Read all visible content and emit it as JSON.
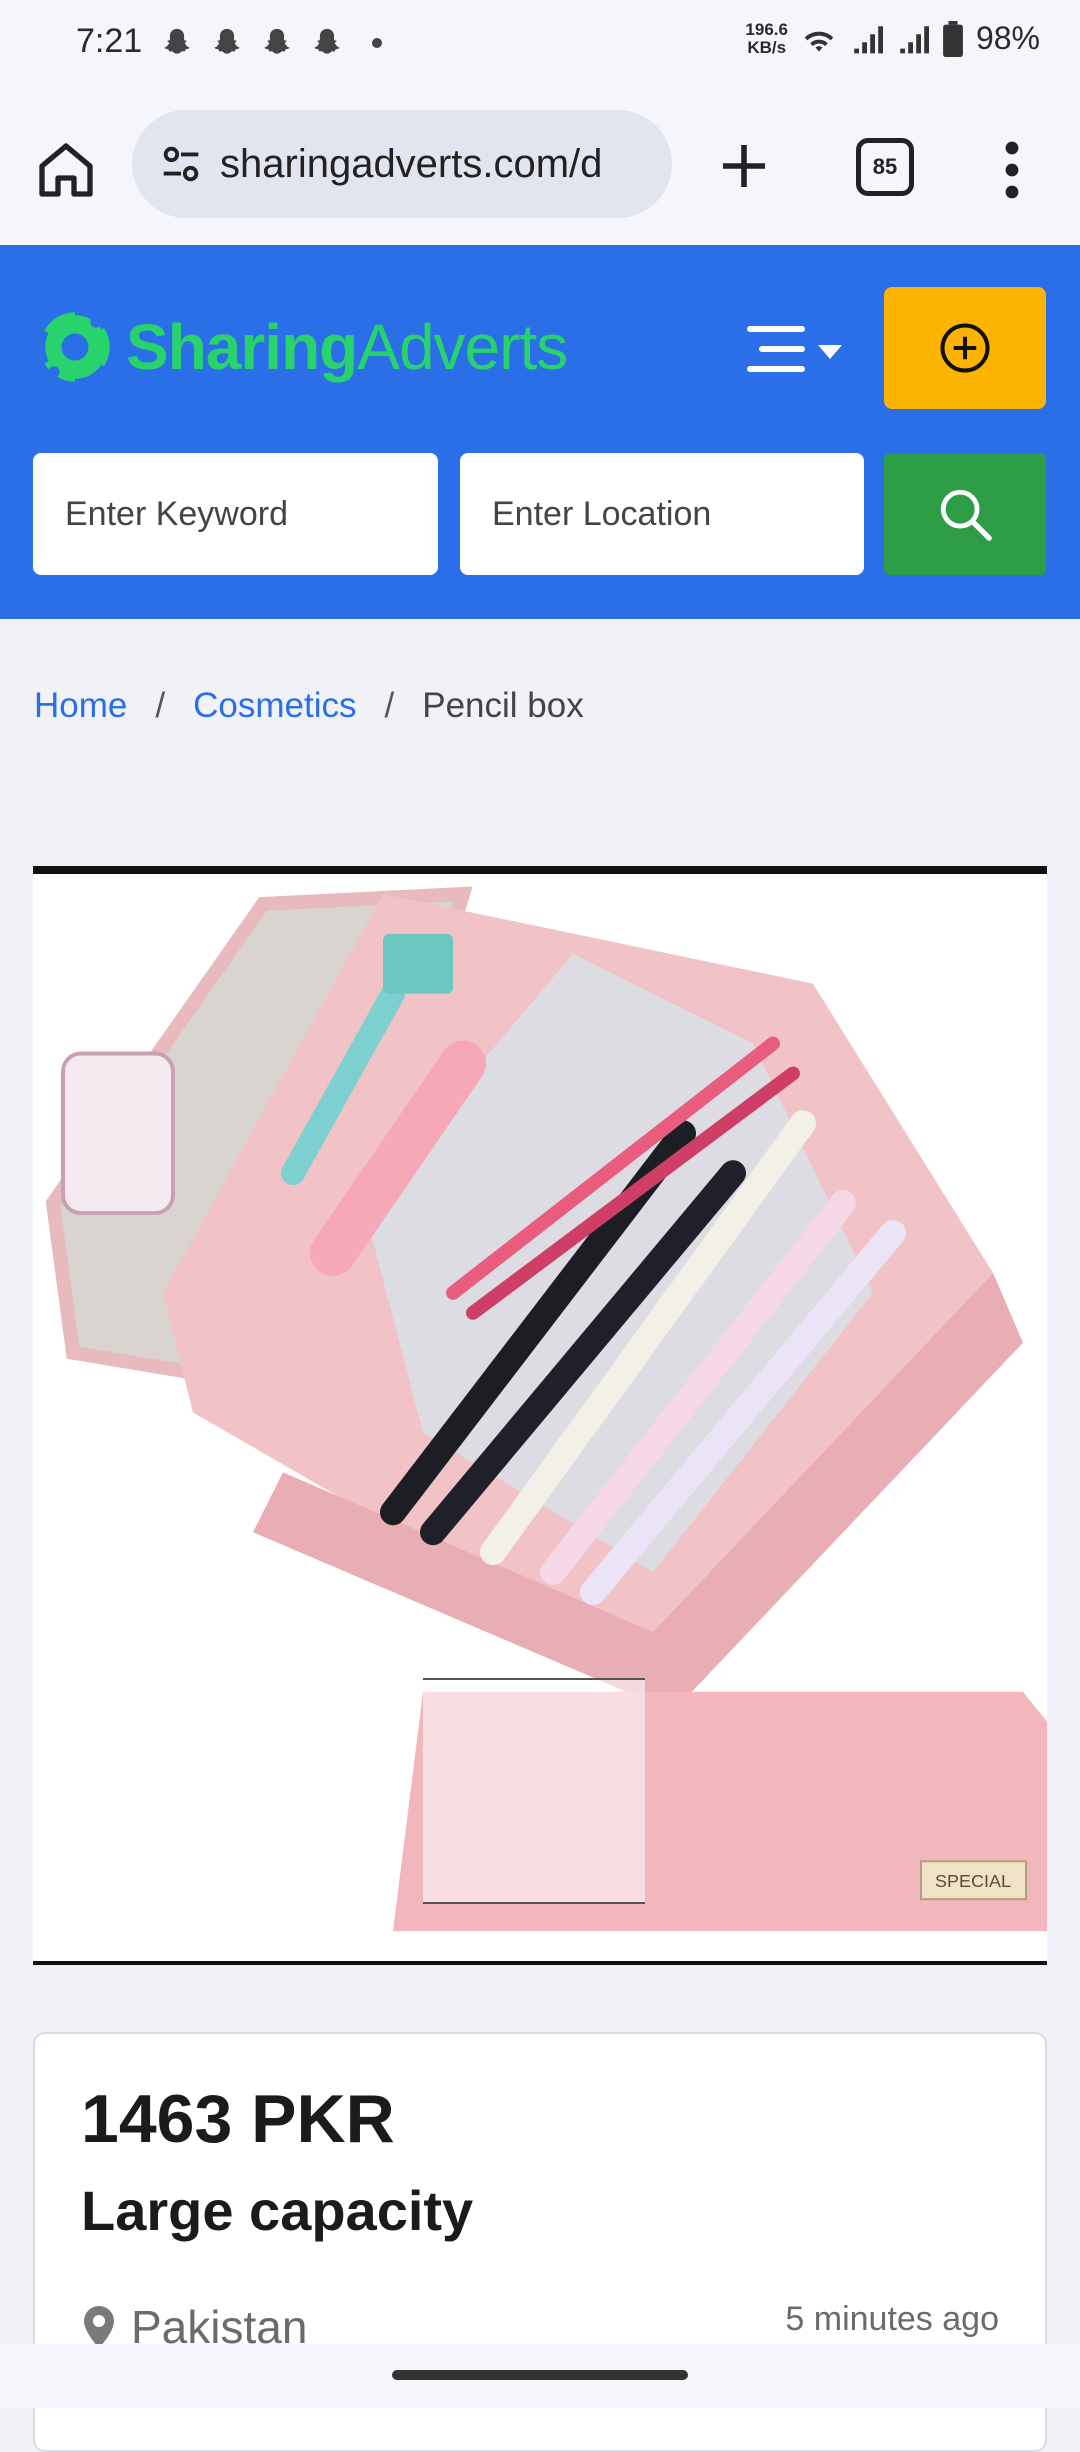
{
  "status": {
    "time": "7:21",
    "speed_value": "196.6",
    "speed_unit": "KB/s",
    "battery": "98%"
  },
  "browser": {
    "url": "sharingadverts.com/d",
    "tab_count": "85"
  },
  "header": {
    "logo_part1": "Sharing",
    "logo_part2": "Adverts",
    "keyword_placeholder": "Enter Keyword",
    "location_placeholder": "Enter Location",
    "brand_color": "#2a6fe8",
    "post_color": "#fdb400",
    "search_color": "#2e9e46"
  },
  "breadcrumb": {
    "home": "Home",
    "sep": "/",
    "category": "Cosmetics",
    "current": "Pencil box"
  },
  "product": {
    "stamp_label": "SPECIAL",
    "price": "1463 PKR",
    "title": "Large capacity",
    "location": "Pakistan",
    "posted": "5 minutes ago"
  }
}
